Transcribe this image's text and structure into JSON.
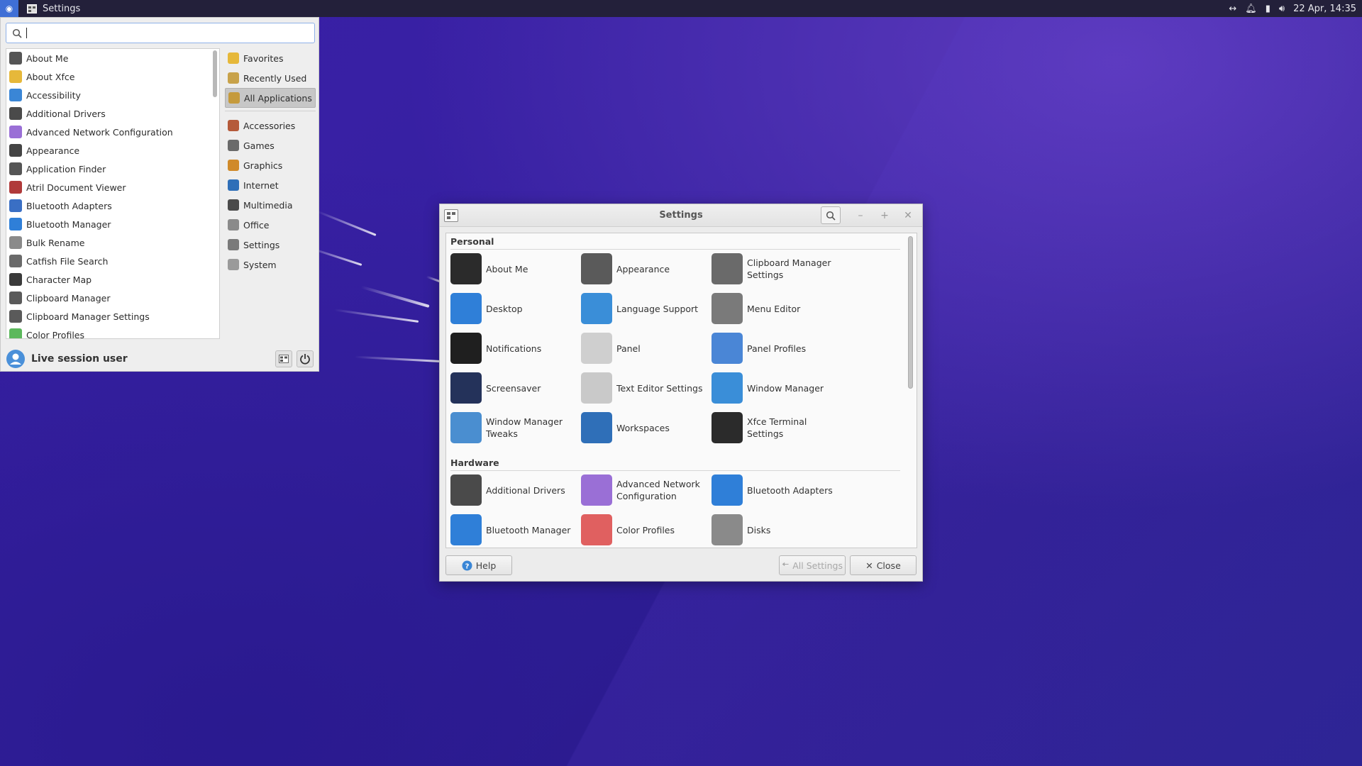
{
  "top_panel": {
    "task_title": "Settings",
    "clock": "22 Apr, 14:35"
  },
  "whisker_menu": {
    "apps": [
      {
        "label": "About Me",
        "icon": "person-icon",
        "color": "#555555"
      },
      {
        "label": "About Xfce",
        "icon": "star-icon",
        "color": "#e6b83a"
      },
      {
        "label": "Accessibility",
        "icon": "accessibility-icon",
        "color": "#3a86d6"
      },
      {
        "label": "Additional Drivers",
        "icon": "circuit-board-icon",
        "color": "#4a4a4a"
      },
      {
        "label": "Advanced Network Configuration",
        "icon": "network-icon",
        "color": "#9a6fd6"
      },
      {
        "label": "Appearance",
        "icon": "paintbrush-icon",
        "color": "#444444"
      },
      {
        "label": "Application Finder",
        "icon": "magnifier-icon",
        "color": "#555555"
      },
      {
        "label": "Atril Document Viewer",
        "icon": "document-viewer-icon",
        "color": "#b03a3a"
      },
      {
        "label": "Bluetooth Adapters",
        "icon": "bluetooth-adapter-icon",
        "color": "#3a6fc4"
      },
      {
        "label": "Bluetooth Manager",
        "icon": "bluetooth-icon",
        "color": "#2f7fd8"
      },
      {
        "label": "Bulk Rename",
        "icon": "rename-icon",
        "color": "#8a8a8a"
      },
      {
        "label": "Catfish File Search",
        "icon": "file-search-icon",
        "color": "#6a6a6a"
      },
      {
        "label": "Character Map",
        "icon": "character-map-icon",
        "color": "#3a3a3a"
      },
      {
        "label": "Clipboard Manager",
        "icon": "clipboard-icon",
        "color": "#5a5a5a"
      },
      {
        "label": "Clipboard Manager Settings",
        "icon": "clipboard-settings-icon",
        "color": "#5a5a5a"
      },
      {
        "label": "Color Profiles",
        "icon": "color-profiles-icon",
        "color": "#5cb85c"
      }
    ],
    "categories": [
      {
        "label": "Favorites",
        "icon": "star-icon",
        "color": "#e6b83a"
      },
      {
        "label": "Recently Used",
        "icon": "clock-icon",
        "color": "#c8a24a"
      },
      {
        "label": "All Applications",
        "icon": "all-apps-icon",
        "color": "#c59a3c",
        "active": true
      },
      {
        "label": "Accessories",
        "icon": "accessories-icon",
        "color": "#b55a3a"
      },
      {
        "label": "Games",
        "icon": "games-icon",
        "color": "#6a6a6a"
      },
      {
        "label": "Graphics",
        "icon": "graphics-icon",
        "color": "#d08a2a"
      },
      {
        "label": "Internet",
        "icon": "globe-icon",
        "color": "#2f6fb8"
      },
      {
        "label": "Multimedia",
        "icon": "multimedia-icon",
        "color": "#4a4a4a"
      },
      {
        "label": "Office",
        "icon": "office-icon",
        "color": "#8a8a8a"
      },
      {
        "label": "Settings",
        "icon": "settings-icon",
        "color": "#7a7a7a"
      },
      {
        "label": "System",
        "icon": "system-gear-icon",
        "color": "#9a9a9a"
      }
    ],
    "user_name": "Live session user"
  },
  "settings_window": {
    "title": "Settings",
    "sections": [
      {
        "title": "Personal",
        "items": [
          {
            "label": "About Me",
            "icon": "about-me-icon",
            "color": "#2b2b2b"
          },
          {
            "label": "Appearance",
            "icon": "appearance-icon",
            "color": "#5a5a5a"
          },
          {
            "label": "Clipboard Manager Settings",
            "icon": "clipboard-icon",
            "color": "#6a6a6a"
          },
          {
            "label": "Desktop",
            "icon": "desktop-monitor-icon",
            "color": "#2f7fd8"
          },
          {
            "label": "Language Support",
            "icon": "language-globe-icon",
            "color": "#3a8ed8"
          },
          {
            "label": "Menu Editor",
            "icon": "menu-editor-icon",
            "color": "#7a7a7a"
          },
          {
            "label": "Notifications",
            "icon": "notifications-icon",
            "color": "#1f1f1f"
          },
          {
            "label": "Panel",
            "icon": "panel-icon",
            "color": "#cfcfcf"
          },
          {
            "label": "Panel Profiles",
            "icon": "panel-profiles-icon",
            "color": "#4a86d6"
          },
          {
            "label": "Screensaver",
            "icon": "screensaver-icon",
            "color": "#24325a"
          },
          {
            "label": "Text Editor Settings",
            "icon": "text-editor-icon",
            "color": "#c9c9c9"
          },
          {
            "label": "Window Manager",
            "icon": "window-manager-icon",
            "color": "#3a8ed8"
          },
          {
            "label": "Window Manager Tweaks",
            "icon": "wm-tweaks-icon",
            "color": "#4a8ed0"
          },
          {
            "label": "Workspaces",
            "icon": "workspaces-icon",
            "color": "#2f6fb8"
          },
          {
            "label": "Xfce Terminal Settings",
            "icon": "terminal-icon",
            "color": "#2b2b2b"
          }
        ]
      },
      {
        "title": "Hardware",
        "items": [
          {
            "label": "Additional Drivers",
            "icon": "drivers-icon",
            "color": "#4a4a4a"
          },
          {
            "label": "Advanced Network Configuration",
            "icon": "network-config-icon",
            "color": "#9a6fd6"
          },
          {
            "label": "Bluetooth Adapters",
            "icon": "bluetooth-adapters-icon",
            "color": "#2f7fd8"
          },
          {
            "label": "Bluetooth Manager",
            "icon": "bluetooth-manager-icon",
            "color": "#2f7fd8"
          },
          {
            "label": "Color Profiles",
            "icon": "color-profiles-icon",
            "color": "#e06060"
          },
          {
            "label": "Disks",
            "icon": "disks-icon",
            "color": "#8a8a8a"
          }
        ]
      }
    ],
    "help_label": "Help",
    "all_settings_label": "All Settings",
    "close_label": "Close"
  }
}
